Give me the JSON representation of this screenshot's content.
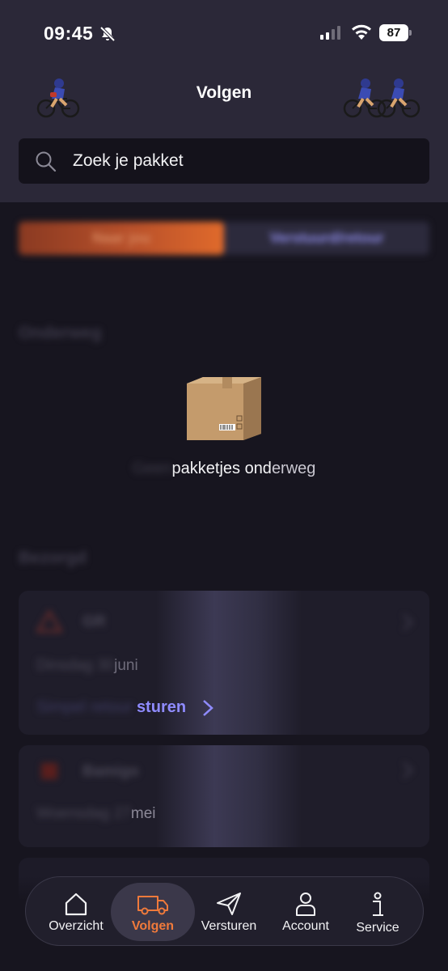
{
  "status_bar": {
    "time": "09:45",
    "battery": "87"
  },
  "header": {
    "title": "Volgen"
  },
  "search": {
    "placeholder": "Zoek je pakket"
  },
  "segment": {
    "left": "Naar jou",
    "right": "Verstuurd/retour"
  },
  "sections": {
    "onderweg": "Onderweg",
    "bezorgd": "Bezorgd"
  },
  "empty_state": {
    "prefix": "Geen ",
    "middle": "pakketjes ond",
    "suffix": "erweg"
  },
  "cards": [
    {
      "name": "GR",
      "date_prefix": "Dinsdag 30 ",
      "date_suffix": "juni",
      "link_prefix": "Simpel retour",
      "link_suffix": "sturen",
      "logo_color": "#c0392b"
    },
    {
      "name": "Bamigo",
      "date_prefix": "Woensdag 27 ",
      "date_suffix": "mei",
      "logo_color": "#b03024"
    }
  ],
  "nav": [
    {
      "label": "Overzicht",
      "icon": "home-icon"
    },
    {
      "label": "Volgen",
      "icon": "delivery-van-icon",
      "active": true
    },
    {
      "label": "Versturen",
      "icon": "paper-plane-icon"
    },
    {
      "label": "Account",
      "icon": "user-icon"
    },
    {
      "label": "Service",
      "icon": "info-icon"
    }
  ],
  "colors": {
    "accent": "#f07a3b",
    "link": "#8f8bff",
    "header_bg": "#2b2838",
    "page_bg": "#17151f"
  }
}
